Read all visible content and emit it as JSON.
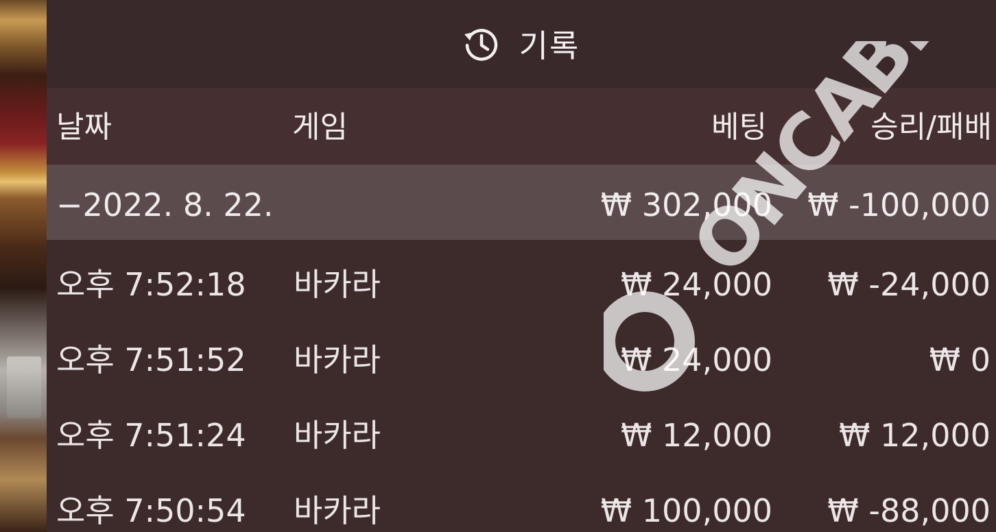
{
  "header": {
    "title": "기록",
    "icon": "history-icon"
  },
  "columns": {
    "date": "날짜",
    "game": "게임",
    "bet": "베팅",
    "win_loss": "승리/패배"
  },
  "summary": {
    "date": "−2022. 8. 22.",
    "bet": "₩ 302,000",
    "win_loss": "₩ -100,000"
  },
  "rows": [
    {
      "time": "오후 7:52:18",
      "game": "바카라",
      "bet": "₩ 24,000",
      "win_loss": "₩ -24,000"
    },
    {
      "time": "오후 7:51:52",
      "game": "바카라",
      "bet": "₩ 24,000",
      "win_loss": "₩ 0"
    },
    {
      "time": "오후 7:51:24",
      "game": "바카라",
      "bet": "₩ 12,000",
      "win_loss": "₩ 12,000"
    },
    {
      "time": "오후 7:50:54",
      "game": "바카라",
      "bet": "₩ 100,000",
      "win_loss": "₩ -88,000"
    }
  ],
  "watermark": {
    "text": "ONCABEST"
  },
  "colors": {
    "panel": "#3d2b2c",
    "header_row": "#452f31",
    "summary_row": "#5b4b4c",
    "text": "#f1ecec"
  }
}
